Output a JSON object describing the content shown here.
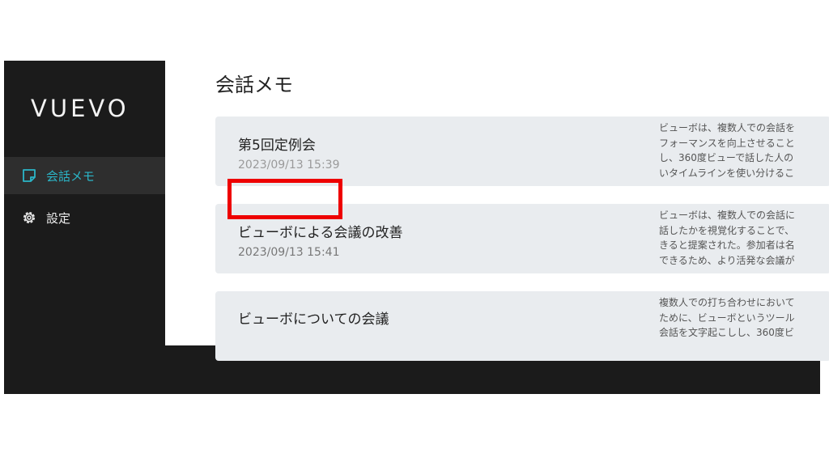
{
  "sidebar": {
    "logo": "VUEVO",
    "items": [
      {
        "label": "会話メモ",
        "icon": "note-icon",
        "active": true
      },
      {
        "label": "設定",
        "icon": "gear-icon",
        "active": false
      }
    ]
  },
  "main": {
    "title": "会話メモ",
    "memos": [
      {
        "title": "第5回定例会",
        "date": "2023/09/13 15:39",
        "summary": [
          "ビューボは、複数人での会話を",
          "フォーマンスを向上させること",
          "し、360度ビューで話した人の",
          "いタイムラインを使い分けるこ"
        ]
      },
      {
        "title": "ビューボによる会議の改善",
        "date": "2023/09/13 15:41",
        "summary": [
          "ビューボは、複数人での会話に",
          "話したかを視覚化することで、",
          "きると提案された。参加者は名",
          "できるため、より活発な会議が"
        ]
      },
      {
        "title": "ビューボについての会議",
        "date": "",
        "summary": [
          "複数人での打ち合わせにおいて",
          "ために、ビューボというツール",
          "会話を文字起こしし、360度ビ"
        ]
      }
    ]
  },
  "colors": {
    "sidebar_bg": "#1b1b1b",
    "accent": "#2bb6c8",
    "card_bg": "#e9ecef",
    "highlight": "#ee0000"
  }
}
